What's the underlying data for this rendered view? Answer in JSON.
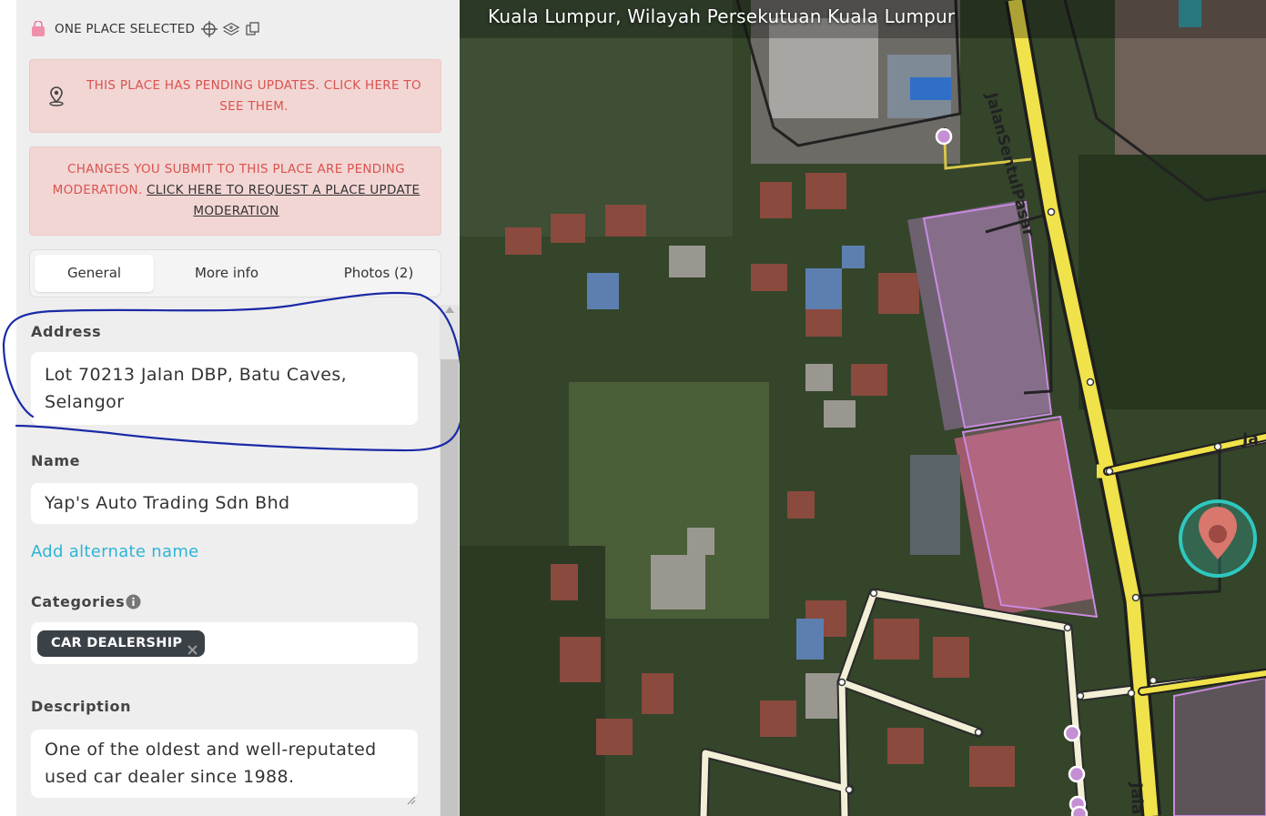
{
  "toolbar": {
    "selection_label": "ONE PLACE SELECTED",
    "icons": [
      "shopping-bag-icon",
      "crosshair-icon",
      "layers-icon",
      "copy-icon"
    ]
  },
  "alerts": {
    "pending_updates": "THIS PLACE HAS PENDING UPDATES. CLICK HERE TO SEE THEM.",
    "pending_moderation_prefix": "CHANGES YOU SUBMIT TO THIS PLACE ARE PENDING MODERATION.",
    "pending_moderation_link": "CLICK HERE TO REQUEST A PLACE UPDATE MODERATION"
  },
  "tabs": [
    {
      "label": "General",
      "selected": true
    },
    {
      "label": "More info",
      "selected": false
    },
    {
      "label": "Photos (2)",
      "selected": false
    }
  ],
  "form": {
    "address_label": "Address",
    "address_value": "Lot 70213 Jalan DBP, Batu Caves, Selangor",
    "name_label": "Name",
    "name_value": "Yap's Auto Trading Sdn Bhd",
    "add_alternate_name": "Add alternate name",
    "categories_label": "Categories",
    "categories": [
      "CAR DEALERSHIP"
    ],
    "description_label": "Description",
    "description_value": "One of the oldest and well-reputated used car dealer since 1988."
  },
  "map": {
    "location_title": "Kuala Lumpur, Wilayah Persekutuan Kuala Lumpur",
    "road_labels": {
      "sentul": "JalanSentulPasar",
      "ka": "Jalan Ka",
      "ja": "Ja"
    }
  },
  "colors": {
    "alert_bg": "#f2d6d4",
    "alert_text": "#d9534f",
    "link": "#2fb4d6",
    "chip_bg": "#3a4147",
    "annotation": "#1a2aa6",
    "road_main": "#f0e24a",
    "road_minor": "#f3efd6",
    "place_outline": "#c98be0",
    "selected_marker": "#2ec8c0"
  }
}
